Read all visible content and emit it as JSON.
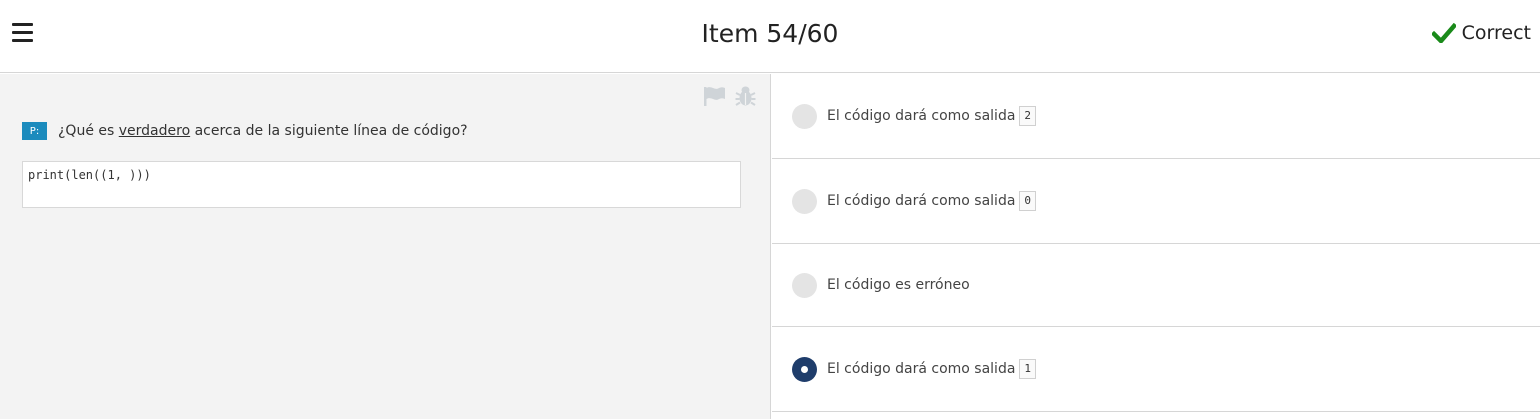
{
  "header": {
    "title": "Item 54/60",
    "status": "Correct",
    "status_color": "#1a8a1a",
    "menu_icon": "hamburger-menu-icon",
    "status_icon": "checkmark-icon"
  },
  "question": {
    "badge": "P:",
    "text_before": "¿Qué es ",
    "text_emphasis": "verdadero",
    "text_after": " acerca de la siguiente línea de código?",
    "code": "print(len((1, )))",
    "icons": [
      "flag-icon",
      "bug-icon"
    ]
  },
  "options": [
    {
      "label": "El código dará como salida",
      "code": "2",
      "selected": false
    },
    {
      "label": "El código dará como salida",
      "code": "0",
      "selected": false
    },
    {
      "label": "El código es erróneo",
      "code": null,
      "selected": false
    },
    {
      "label": "El código dará como salida",
      "code": "1",
      "selected": true
    }
  ]
}
